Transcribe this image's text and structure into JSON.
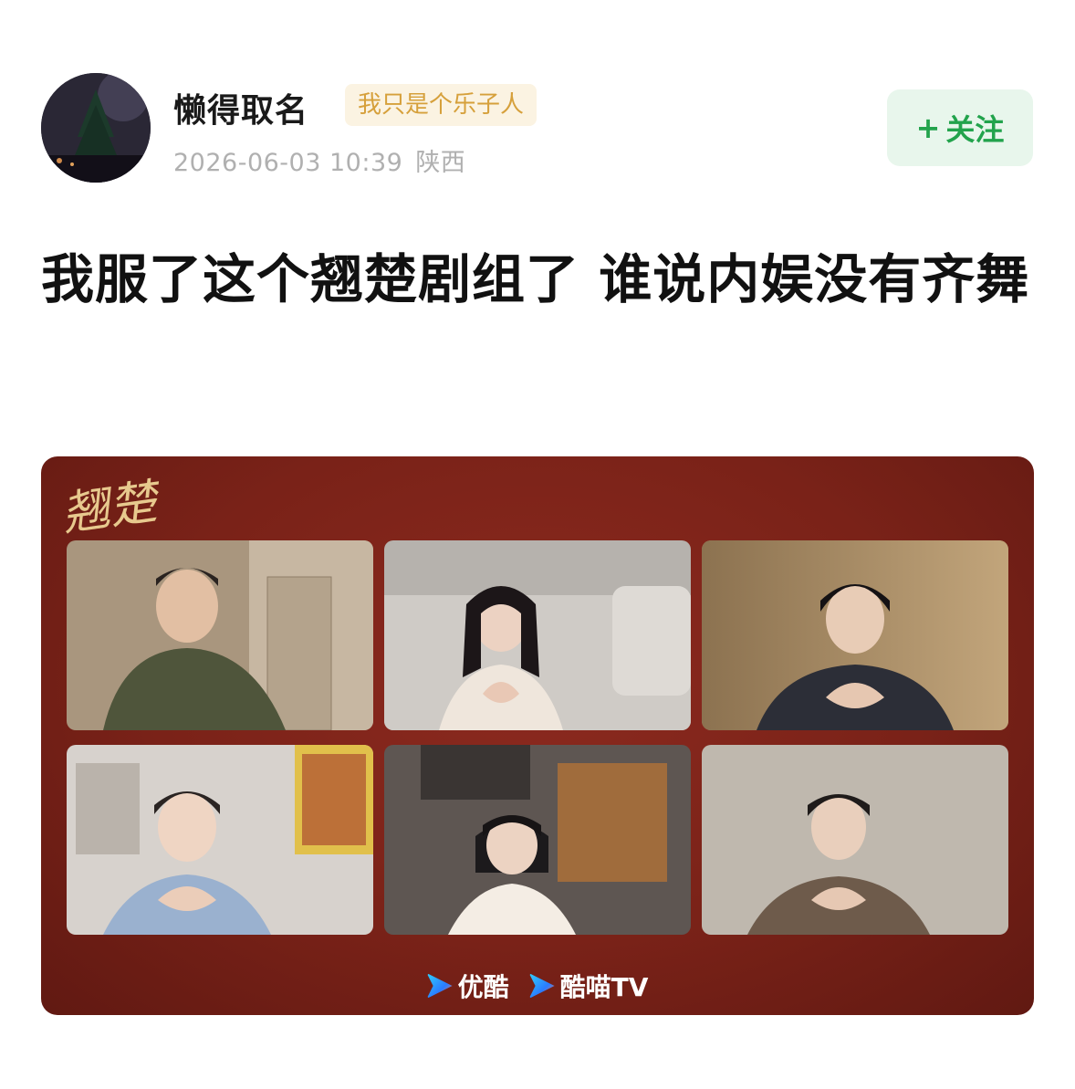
{
  "post": {
    "username": "懒得取名",
    "user_tag": "我只是个乐子人",
    "timestamp": "2026-06-03 10:39",
    "location": "陕西",
    "follow": {
      "plus": "+",
      "label": "关注"
    },
    "title": "我服了这个翘楚剧组了 谁说内娱没有齐舞"
  },
  "media": {
    "show_logo": "翘楚",
    "brands": [
      {
        "label": "优酷",
        "icon": "youku-icon"
      },
      {
        "label": "酷喵TV",
        "icon": "kumiao-icon"
      }
    ]
  },
  "colors": {
    "follow_bg": "#e8f6ec",
    "follow_text": "#22a34c",
    "tag_bg": "#fbf3e2",
    "tag_text": "#d6a03b",
    "media_bg": "#7a2218"
  }
}
